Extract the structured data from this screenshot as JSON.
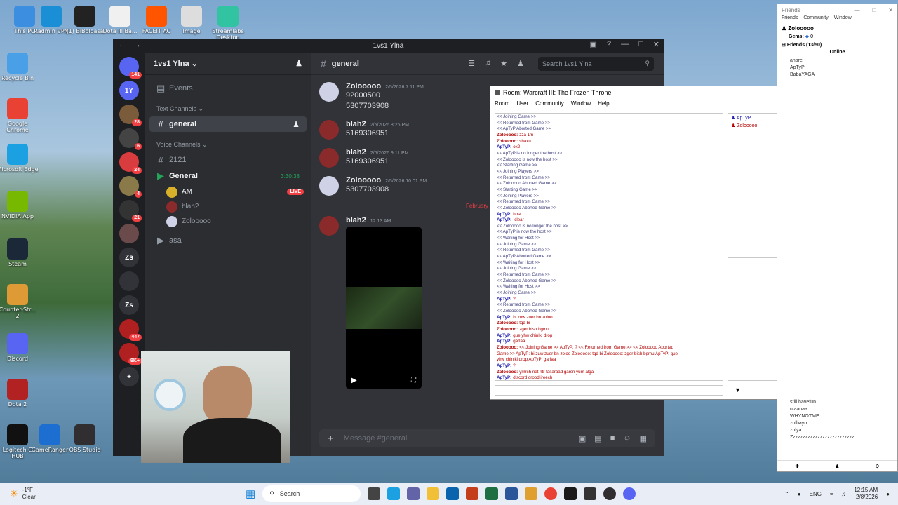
{
  "desktop": {
    "icons": [
      {
        "label": "This PC",
        "color": "#3b8ee0"
      },
      {
        "label": "Radmin VPN",
        "color": "#1a8fd6"
      },
      {
        "label": "(1) BiBoloasa",
        "color": "#222222"
      },
      {
        "label": "Dota Ill Ba...",
        "color": "#f0f0f0"
      },
      {
        "label": "FACEIT AC",
        "color": "#ff5500"
      },
      {
        "label": "Image",
        "color": "#dddddd"
      },
      {
        "label": "Streamlabs Desktop",
        "color": "#31c3a2"
      },
      {
        "label": "Recycle Bin",
        "color": "#4aa0e6"
      },
      {
        "label": "Google Chrome",
        "color": "#e94235"
      },
      {
        "label": "Microsoft Edge",
        "color": "#1ba1e2"
      },
      {
        "label": "NVIDIA App",
        "color": "#76b900"
      },
      {
        "label": "Steam",
        "color": "#1b2838"
      },
      {
        "label": "Counter-Str... 2",
        "color": "#de9b35"
      },
      {
        "label": "Discord",
        "color": "#5865f2"
      },
      {
        "label": "Dota 2",
        "color": "#b22222"
      },
      {
        "label": "Logitech G HUB",
        "color": "#111111"
      },
      {
        "label": "GameRanger",
        "color": "#1c6fd1"
      },
      {
        "label": "OBS Studio",
        "color": "#302e31"
      }
    ]
  },
  "discord": {
    "window_title": "1vs1 Ylna",
    "guild_name": "1vs1 Ylna",
    "servers": [
      {
        "label": "",
        "badge": "141",
        "color": "#5865f2"
      },
      {
        "label": "1Y",
        "badge": "",
        "color": "#5865f2"
      },
      {
        "label": "",
        "badge": "28",
        "color": "#7a5c3a"
      },
      {
        "label": "",
        "badge": "6",
        "color": "#444444"
      },
      {
        "label": "",
        "badge": "24",
        "color": "#d83c3e"
      },
      {
        "label": "",
        "badge": "4",
        "color": "#8a7a4a"
      },
      {
        "label": "",
        "badge": "21",
        "color": "#333333"
      },
      {
        "label": "",
        "badge": "",
        "color": "#6a4a4a"
      },
      {
        "label": "Zs",
        "badge": "",
        "color": "#313338"
      },
      {
        "label": "",
        "badge": "",
        "color": "#313338"
      },
      {
        "label": "Zs",
        "badge": "",
        "color": "#313338"
      },
      {
        "label": "",
        "badge": "447",
        "color": "#b02020"
      },
      {
        "label": "",
        "badge": "9K+",
        "color": "#b02020"
      },
      {
        "label": "+",
        "badge": "",
        "color": "#313338"
      }
    ],
    "events_label": "Events",
    "text_channels_label": "Text Channels",
    "text_channels": [
      {
        "name": "general",
        "active": true
      }
    ],
    "voice_channels_label": "Voice Channels",
    "voice_channels": [
      {
        "name": "2121",
        "timer": ""
      },
      {
        "name": "General",
        "timer": "3:30:38"
      }
    ],
    "voice_users": [
      {
        "name": "AM",
        "live": "LIVE",
        "color": "#d8b02a"
      },
      {
        "name": "blah2",
        "live": "",
        "color": "#8a2a2a"
      },
      {
        "name": "Zolooooo",
        "live": "",
        "color": "#cfd2e6"
      }
    ],
    "extra_channel": "asa",
    "chat_channel": "general",
    "search_placeholder": "Search 1vs1 Ylna",
    "messages": [
      {
        "author": "Zolooooo",
        "time": "2/5/2026 7:11 PM",
        "lines": [
          "92000500",
          "5307703908"
        ],
        "color": "#cfd2e6"
      },
      {
        "author": "blah2",
        "time": "2/5/2026 8:26 PM",
        "lines": [
          "5169306951"
        ],
        "color": "#8a2a2a"
      },
      {
        "author": "blah2",
        "time": "2/6/2026 9:11 PM",
        "lines": [
          "5169306951"
        ],
        "color": "#8a2a2a"
      },
      {
        "author": "Zolooooo",
        "time": "2/5/2026 10:01 PM",
        "lines": [
          "5307703908"
        ],
        "color": "#cfd2e6"
      }
    ],
    "date_divider": "February 8, 2026",
    "last_message": {
      "author": "blah2",
      "time": "12:13 AM",
      "color": "#8a2a2a"
    },
    "composer_placeholder": "Message #general"
  },
  "w3": {
    "title": "Room: Warcraft III: The Frozen Throne",
    "menu": [
      "Room",
      "User",
      "Community",
      "Window",
      "Help"
    ],
    "log": [
      {
        "type": "sys",
        "text": "<< Joining Game >>"
      },
      {
        "type": "sys",
        "text": "<< Returned from Game >>"
      },
      {
        "type": "sys",
        "text": "<< ApTyP Aborted Game >>"
      },
      {
        "type": "zo",
        "user": "Zolooooo:",
        "text": "zza 1m"
      },
      {
        "type": "zo",
        "user": "Zolooooo:",
        "text": "shaxu"
      },
      {
        "type": "ap",
        "user": "ApTyP:",
        "text": "ok2"
      },
      {
        "type": "sys",
        "text": "<< ApTyP is no longer the host >>"
      },
      {
        "type": "sys",
        "text": "<< Zolooooo is now the host >>"
      },
      {
        "type": "sys",
        "text": "<< Starting Game >>"
      },
      {
        "type": "sys",
        "text": "<< Joining Players >>"
      },
      {
        "type": "sys",
        "text": "<< Returned from Game >>"
      },
      {
        "type": "sys",
        "text": "<< Zolooooo Aborted Game >>"
      },
      {
        "type": "sys",
        "text": "<< Starting Game >>"
      },
      {
        "type": "sys",
        "text": "<< Joining Players >>"
      },
      {
        "type": "sys",
        "text": "<< Returned from Game >>"
      },
      {
        "type": "sys",
        "text": "<< Zolooooo Aborted Game >>"
      },
      {
        "type": "ap",
        "user": "ApTyP:",
        "text": "host"
      },
      {
        "type": "ap",
        "user": "ApTyP:",
        "text": "-clear"
      },
      {
        "type": "sys",
        "text": "<< Zolooooo is no longer the host >>"
      },
      {
        "type": "sys",
        "text": "<< ApTyP is now the host >>"
      },
      {
        "type": "sys",
        "text": "<< Waiting for Host >>"
      },
      {
        "type": "sys",
        "text": "<< Joining Game >>"
      },
      {
        "type": "sys",
        "text": "<< Returned from Game >>"
      },
      {
        "type": "sys",
        "text": "<< ApTyP Aborted Game >>"
      },
      {
        "type": "sys",
        "text": "<< Waiting for Host >>"
      },
      {
        "type": "sys",
        "text": "<< Joining Game >>"
      },
      {
        "type": "sys",
        "text": "<< Returned from Game >>"
      },
      {
        "type": "sys",
        "text": "<< Zolooooo Aborted Game >>"
      },
      {
        "type": "sys",
        "text": "<< Waiting for Host >>"
      },
      {
        "type": "sys",
        "text": "<< Joining Game >>"
      },
      {
        "type": "ap",
        "user": "ApTyP:",
        "text": "?"
      },
      {
        "type": "sys",
        "text": "<< Returned from Game >>"
      },
      {
        "type": "sys",
        "text": "<< Zolooooo Aborted Game >>"
      },
      {
        "type": "ap",
        "user": "ApTyP:",
        "text": "bi zuw zuer bn zoloo"
      },
      {
        "type": "zo",
        "user": "Zolooooo:",
        "text": "tgd bi"
      },
      {
        "type": "zo",
        "user": "Zolooooo:",
        "text": "zger bish bgmu"
      },
      {
        "type": "ap",
        "user": "ApTyP:",
        "text": "gue yhw chinlkl drop"
      },
      {
        "type": "ap",
        "user": "ApTyP:",
        "text": "garlaa"
      },
      {
        "type": "zo",
        "user": "Zolooooo:",
        "text": "<< Joining Game >> ApTyP: ? << Returned from Game >> << Zolooooo Aborted"
      },
      {
        "type": "zo2",
        "text": "Game >> ApTyP: bi zuw zuer bn zoloo Zolooooo: tgd bi Zolooooo: zger bish bgmu ApTyP: gue"
      },
      {
        "type": "zo2",
        "text": "yhw chinlkl drop ApTyP: garlaa"
      },
      {
        "type": "ap",
        "user": "ApTyP:",
        "text": "?"
      },
      {
        "type": "zo",
        "user": "Zolooooo:",
        "text": "ymrch net ntr tasaraad garsn yum alga"
      },
      {
        "type": "ap",
        "user": "ApTyP:",
        "text": "discord orood irеech"
      }
    ],
    "users": [
      "ApTyP",
      "Zolooooo"
    ]
  },
  "friends": {
    "title": "Friends",
    "menu": [
      "Friends",
      "Community",
      "Window"
    ],
    "self_name": "Zolooooo",
    "gems_label": "Gems:",
    "gems_value": "0",
    "group_label": "Friends (13/50)",
    "online_label": "Online",
    "online": [
      "anare",
      "ApTyP",
      "BabaYAGA"
    ],
    "offline": [
      "still.havefun",
      "ulaanaa",
      "WHYNOTME",
      "zolbayrr",
      "zulya",
      "Zzzzzzzzzzzzzzzzzzzzzzzzzz"
    ]
  },
  "taskbar": {
    "weather_temp": "-1°F",
    "weather_text": "Clear",
    "search_label": "Search",
    "language": "ENG",
    "time": "12:15 AM",
    "date": "2/8/2026"
  }
}
